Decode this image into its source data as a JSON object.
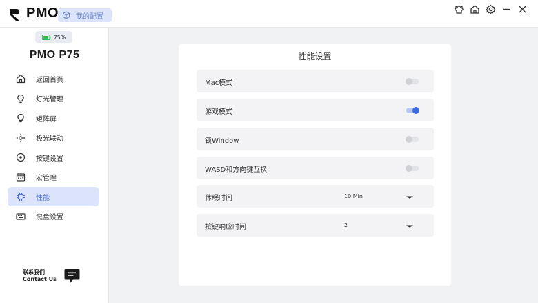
{
  "app": {
    "logo_text": "PMO",
    "config_label": "我的配置"
  },
  "sidebar": {
    "battery": "75%",
    "device_name": "PMO P75",
    "items": [
      {
        "label": "返回首页",
        "icon": "home-icon"
      },
      {
        "label": "灯光管理",
        "icon": "bulb-icon"
      },
      {
        "label": "矩阵屏",
        "icon": "bulb-icon"
      },
      {
        "label": "极光联动",
        "icon": "aurora-icon"
      },
      {
        "label": "按键设置",
        "icon": "key-settings-icon"
      },
      {
        "label": "宏管理",
        "icon": "macro-icon"
      },
      {
        "label": "性能",
        "icon": "chip-icon"
      },
      {
        "label": "键盘设置",
        "icon": "keyboard-icon"
      }
    ],
    "active_index": 6,
    "contact": {
      "cn": "联系我们",
      "en": "Contact Us"
    }
  },
  "panel": {
    "title": "性能设置",
    "rows": [
      {
        "label": "Mac模式",
        "type": "toggle",
        "on": false
      },
      {
        "label": "游戏模式",
        "type": "toggle",
        "on": true
      },
      {
        "label": "锁Window",
        "type": "toggle",
        "on": false
      },
      {
        "label": "WASD和方向键互换",
        "type": "toggle",
        "on": false
      },
      {
        "label": "休眠时间",
        "type": "select",
        "value": "10 Min"
      },
      {
        "label": "按键响应时间",
        "type": "select",
        "value": "2"
      }
    ]
  },
  "colors": {
    "accent": "#3f6ee0",
    "accent_light": "#dbe4fb",
    "battery_green": "#2ebd5a"
  }
}
